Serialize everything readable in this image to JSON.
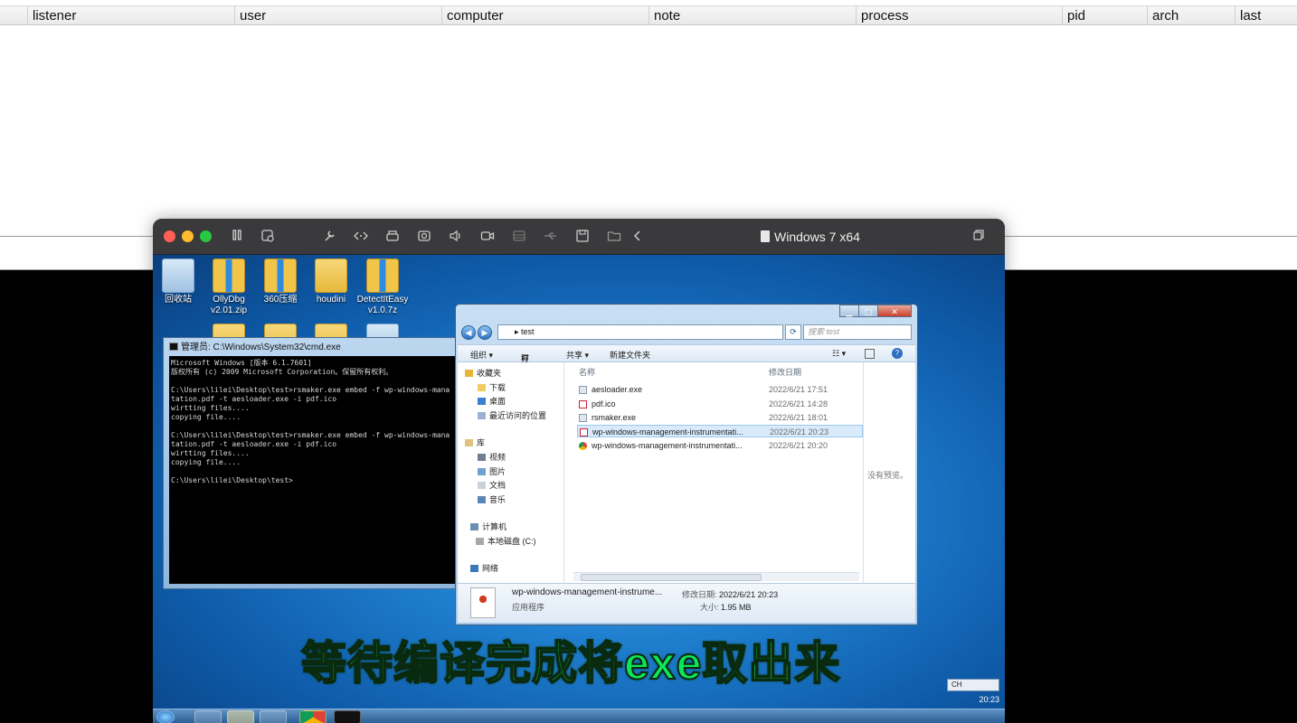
{
  "listener_table": {
    "columns": [
      "listener",
      "user",
      "computer",
      "note",
      "process",
      "pid",
      "arch",
      "last"
    ]
  },
  "vm": {
    "title": "Windows 7 x64",
    "toolbar_icons": [
      "pause-icon",
      "snapshot-icon",
      "wrench-icon",
      "code-icon",
      "printer-icon",
      "camera-icon",
      "speaker-icon",
      "video-icon",
      "storage-icon",
      "usb-icon",
      "save-icon",
      "folder-share-icon",
      "back-icon"
    ]
  },
  "desktop": {
    "icons": [
      {
        "label": "回收站",
        "sub": "",
        "kind": "recycle"
      },
      {
        "label": "OllyDbg",
        "sub": "v2.01.zip",
        "kind": "zip"
      },
      {
        "label": "360压缩",
        "sub": "",
        "kind": "zip"
      },
      {
        "label": "houdini",
        "sub": "",
        "kind": "folder"
      },
      {
        "label": "DetectItEasy",
        "sub": "v1.0.7z",
        "kind": "zip"
      }
    ]
  },
  "cmd": {
    "title": "管理员: C:\\Windows\\System32\\cmd.exe",
    "lines": [
      "Microsoft Windows [版本 6.1.7601]",
      "版权所有 (c) 2009 Microsoft Corporation。保留所有权利。",
      "",
      "C:\\Users\\lilei\\Desktop\\test>rsmaker.exe embed -f wp-windows-mana",
      "tation.pdf -t aesloader.exe -i pdf.ico",
      "wirtting files....",
      "copying file....",
      "",
      "C:\\Users\\lilei\\Desktop\\test>rsmaker.exe embed -f wp-windows-mana",
      "tation.pdf -t aesloader.exe -i pdf.ico",
      "wirtting files....",
      "copying file....",
      "",
      "C:\\Users\\lilei\\Desktop\\test>"
    ]
  },
  "explorer": {
    "address": "test",
    "search_placeholder": "搜索 test",
    "commands": [
      "组织 ▾",
      "打开",
      "共享 ▾",
      "新建文件夹"
    ],
    "nav": {
      "favorites": "收藏夹",
      "downloads": "下载",
      "desktop": "桌面",
      "recent": "最近访问的位置",
      "libraries": "库",
      "videos": "视频",
      "pictures": "图片",
      "documents": "文档",
      "music": "音乐",
      "computer": "计算机",
      "local_disk": "本地磁盘 (C:)",
      "network": "网络"
    },
    "col_name": "名称",
    "col_date": "修改日期",
    "files": [
      {
        "name": "aesloader.exe",
        "date": "2022/6/21 17:51",
        "icon": "exe-icon"
      },
      {
        "name": "pdf.ico",
        "date": "2022/6/21 14:28",
        "icon": "pdf-icon"
      },
      {
        "name": "rsmaker.exe",
        "date": "2022/6/21 18:01",
        "icon": "exe-icon"
      },
      {
        "name": "wp-windows-management-instrumentati...",
        "date": "2022/6/21 20:23",
        "icon": "pdf-icon"
      },
      {
        "name": "wp-windows-management-instrumentati...",
        "date": "2022/6/21 20:20",
        "icon": "chrome-icon"
      }
    ],
    "preview_text": "没有预览。",
    "details": {
      "name": "wp-windows-management-instrume...",
      "type": "应用程序",
      "date_label": "修改日期:",
      "date": "2022/6/21 20:23",
      "size_label": "大小:",
      "size": "1.95 MB"
    }
  },
  "subtitle": "等待编译完成将exe取出来",
  "taskbar": {
    "time": "20:23",
    "lang": "CH"
  }
}
